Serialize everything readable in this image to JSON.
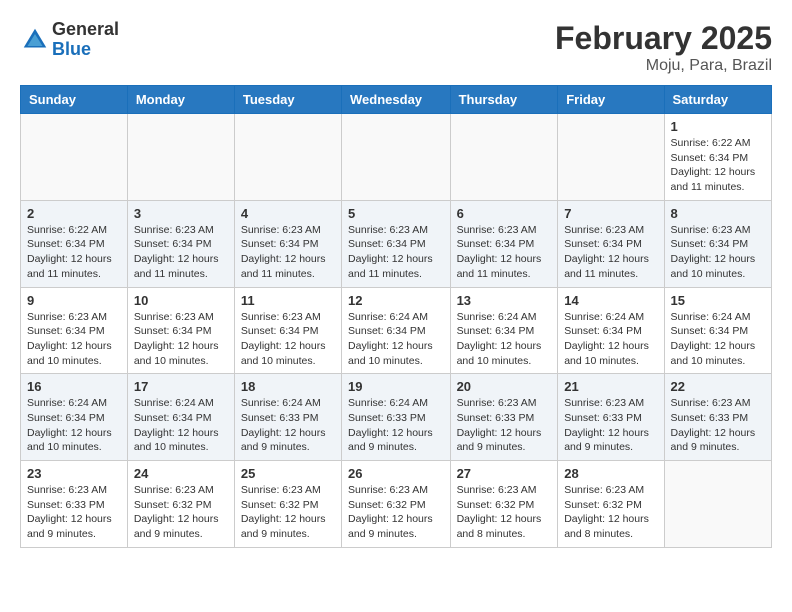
{
  "header": {
    "logo_general": "General",
    "logo_blue": "Blue",
    "month_title": "February 2025",
    "location": "Moju, Para, Brazil"
  },
  "days_of_week": [
    "Sunday",
    "Monday",
    "Tuesday",
    "Wednesday",
    "Thursday",
    "Friday",
    "Saturday"
  ],
  "weeks": [
    {
      "cells": [
        {
          "day": "",
          "detail": ""
        },
        {
          "day": "",
          "detail": ""
        },
        {
          "day": "",
          "detail": ""
        },
        {
          "day": "",
          "detail": ""
        },
        {
          "day": "",
          "detail": ""
        },
        {
          "day": "",
          "detail": ""
        },
        {
          "day": "1",
          "detail": "Sunrise: 6:22 AM\nSunset: 6:34 PM\nDaylight: 12 hours\nand 11 minutes."
        }
      ]
    },
    {
      "cells": [
        {
          "day": "2",
          "detail": "Sunrise: 6:22 AM\nSunset: 6:34 PM\nDaylight: 12 hours\nand 11 minutes."
        },
        {
          "day": "3",
          "detail": "Sunrise: 6:23 AM\nSunset: 6:34 PM\nDaylight: 12 hours\nand 11 minutes."
        },
        {
          "day": "4",
          "detail": "Sunrise: 6:23 AM\nSunset: 6:34 PM\nDaylight: 12 hours\nand 11 minutes."
        },
        {
          "day": "5",
          "detail": "Sunrise: 6:23 AM\nSunset: 6:34 PM\nDaylight: 12 hours\nand 11 minutes."
        },
        {
          "day": "6",
          "detail": "Sunrise: 6:23 AM\nSunset: 6:34 PM\nDaylight: 12 hours\nand 11 minutes."
        },
        {
          "day": "7",
          "detail": "Sunrise: 6:23 AM\nSunset: 6:34 PM\nDaylight: 12 hours\nand 11 minutes."
        },
        {
          "day": "8",
          "detail": "Sunrise: 6:23 AM\nSunset: 6:34 PM\nDaylight: 12 hours\nand 10 minutes."
        }
      ]
    },
    {
      "cells": [
        {
          "day": "9",
          "detail": "Sunrise: 6:23 AM\nSunset: 6:34 PM\nDaylight: 12 hours\nand 10 minutes."
        },
        {
          "day": "10",
          "detail": "Sunrise: 6:23 AM\nSunset: 6:34 PM\nDaylight: 12 hours\nand 10 minutes."
        },
        {
          "day": "11",
          "detail": "Sunrise: 6:23 AM\nSunset: 6:34 PM\nDaylight: 12 hours\nand 10 minutes."
        },
        {
          "day": "12",
          "detail": "Sunrise: 6:24 AM\nSunset: 6:34 PM\nDaylight: 12 hours\nand 10 minutes."
        },
        {
          "day": "13",
          "detail": "Sunrise: 6:24 AM\nSunset: 6:34 PM\nDaylight: 12 hours\nand 10 minutes."
        },
        {
          "day": "14",
          "detail": "Sunrise: 6:24 AM\nSunset: 6:34 PM\nDaylight: 12 hours\nand 10 minutes."
        },
        {
          "day": "15",
          "detail": "Sunrise: 6:24 AM\nSunset: 6:34 PM\nDaylight: 12 hours\nand 10 minutes."
        }
      ]
    },
    {
      "cells": [
        {
          "day": "16",
          "detail": "Sunrise: 6:24 AM\nSunset: 6:34 PM\nDaylight: 12 hours\nand 10 minutes."
        },
        {
          "day": "17",
          "detail": "Sunrise: 6:24 AM\nSunset: 6:34 PM\nDaylight: 12 hours\nand 10 minutes."
        },
        {
          "day": "18",
          "detail": "Sunrise: 6:24 AM\nSunset: 6:33 PM\nDaylight: 12 hours\nand 9 minutes."
        },
        {
          "day": "19",
          "detail": "Sunrise: 6:24 AM\nSunset: 6:33 PM\nDaylight: 12 hours\nand 9 minutes."
        },
        {
          "day": "20",
          "detail": "Sunrise: 6:23 AM\nSunset: 6:33 PM\nDaylight: 12 hours\nand 9 minutes."
        },
        {
          "day": "21",
          "detail": "Sunrise: 6:23 AM\nSunset: 6:33 PM\nDaylight: 12 hours\nand 9 minutes."
        },
        {
          "day": "22",
          "detail": "Sunrise: 6:23 AM\nSunset: 6:33 PM\nDaylight: 12 hours\nand 9 minutes."
        }
      ]
    },
    {
      "cells": [
        {
          "day": "23",
          "detail": "Sunrise: 6:23 AM\nSunset: 6:33 PM\nDaylight: 12 hours\nand 9 minutes."
        },
        {
          "day": "24",
          "detail": "Sunrise: 6:23 AM\nSunset: 6:32 PM\nDaylight: 12 hours\nand 9 minutes."
        },
        {
          "day": "25",
          "detail": "Sunrise: 6:23 AM\nSunset: 6:32 PM\nDaylight: 12 hours\nand 9 minutes."
        },
        {
          "day": "26",
          "detail": "Sunrise: 6:23 AM\nSunset: 6:32 PM\nDaylight: 12 hours\nand 9 minutes."
        },
        {
          "day": "27",
          "detail": "Sunrise: 6:23 AM\nSunset: 6:32 PM\nDaylight: 12 hours\nand 8 minutes."
        },
        {
          "day": "28",
          "detail": "Sunrise: 6:23 AM\nSunset: 6:32 PM\nDaylight: 12 hours\nand 8 minutes."
        },
        {
          "day": "",
          "detail": ""
        }
      ]
    }
  ]
}
